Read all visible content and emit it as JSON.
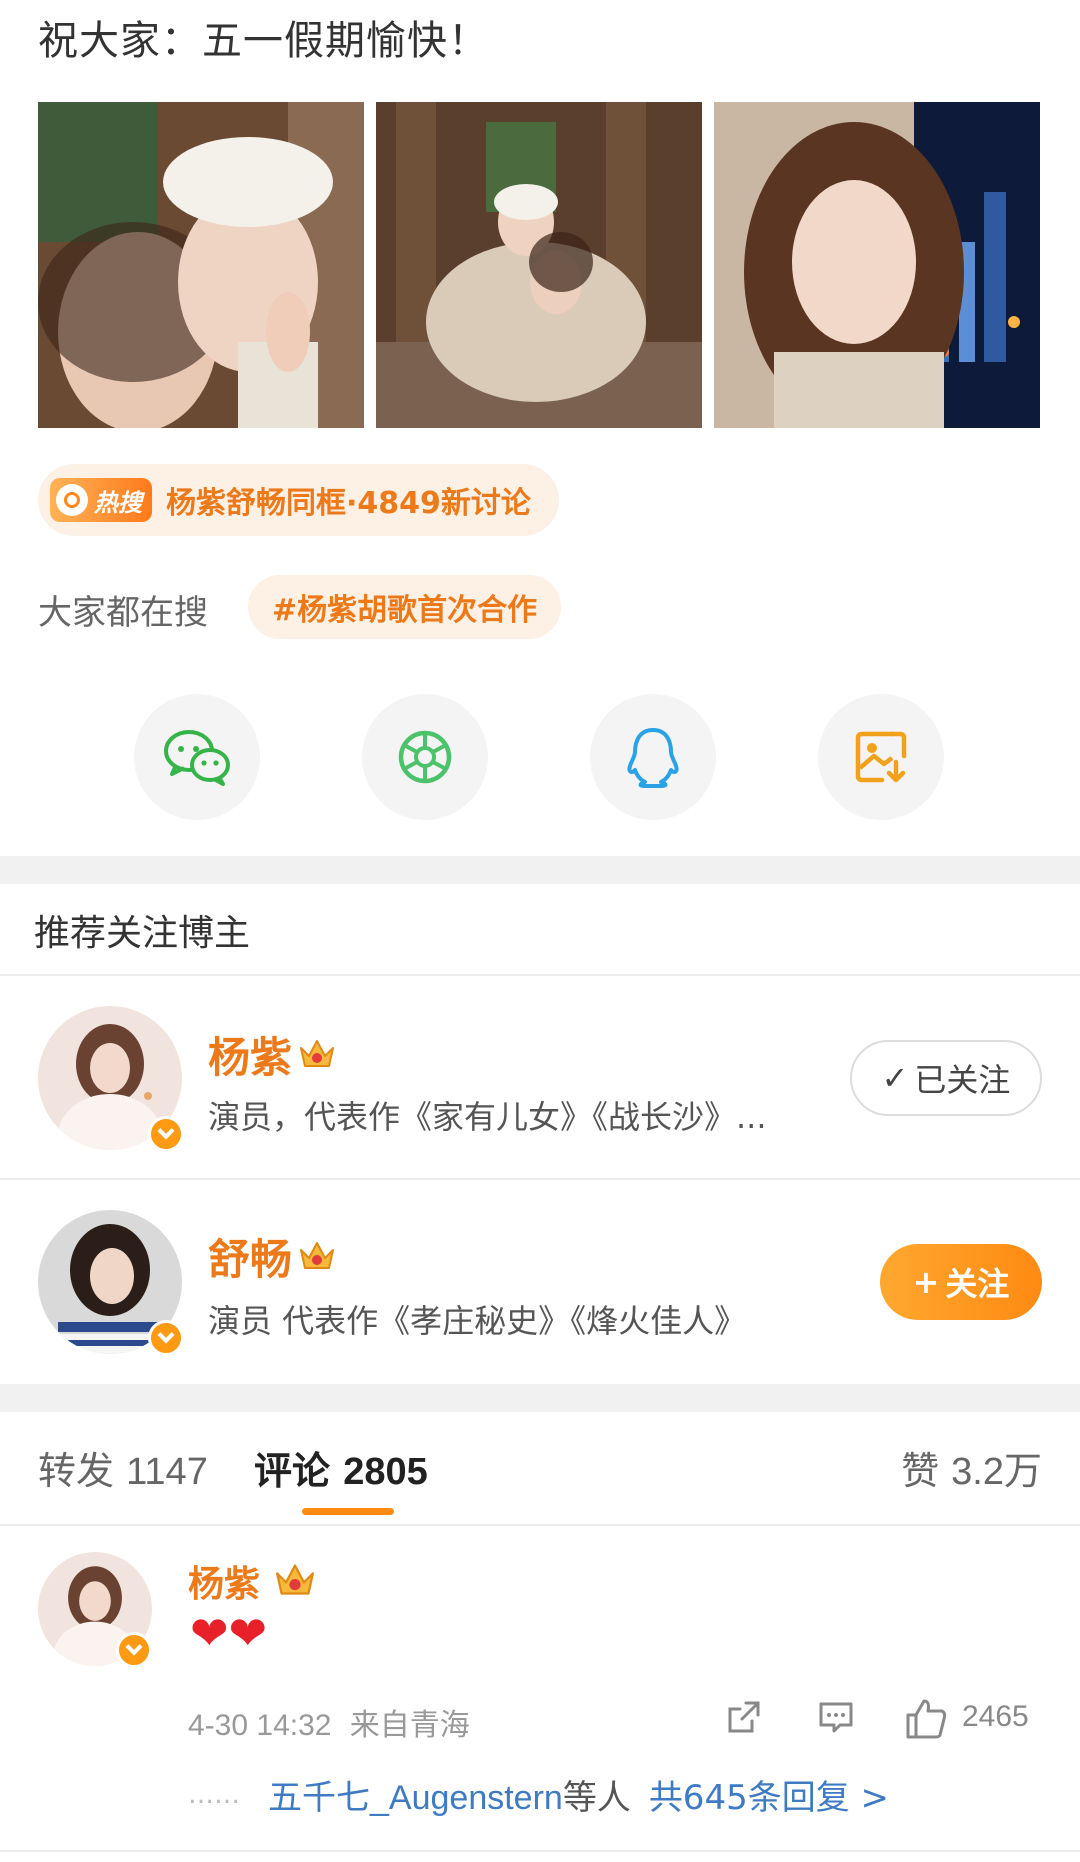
{
  "post": {
    "text": "祝大家：五一假期愉快！"
  },
  "hot_search": {
    "badge": "热搜",
    "text": "杨紫舒畅同框·4849新讨论"
  },
  "search_suggest": {
    "label": "大家都在搜",
    "tag": "#杨紫胡歌首次合作"
  },
  "share": {
    "icons": [
      "wechat-icon",
      "moments-icon",
      "qq-icon",
      "save-image-icon"
    ]
  },
  "recommend": {
    "title": "推荐关注博主",
    "users": [
      {
        "name": "杨紫",
        "desc": "演员，代表作《家有儿女》《战长沙》...",
        "button": "已关注",
        "following": true
      },
      {
        "name": "舒畅",
        "desc": "演员 代表作《孝庄秘史》《烽火佳人》",
        "button": "关注",
        "following": false
      }
    ]
  },
  "tabs": {
    "repost_label": "转发",
    "repost_count": "1147",
    "comment_label": "评论",
    "comment_count": "2805",
    "like_label": "赞",
    "like_count": "3.2万"
  },
  "comment": {
    "name": "杨紫",
    "content": "❤❤",
    "time": "4-30 14:32",
    "location": "来自青海",
    "like_count": "2465",
    "reply_user": "五千七_Augenstern",
    "reply_mid": "等人",
    "reply_total": "共645条回复 >"
  },
  "colors": {
    "accent": "#ec7a1b",
    "link": "#3f7bc2",
    "heart": "#e8202a",
    "follow_button": "#ff9a12"
  }
}
